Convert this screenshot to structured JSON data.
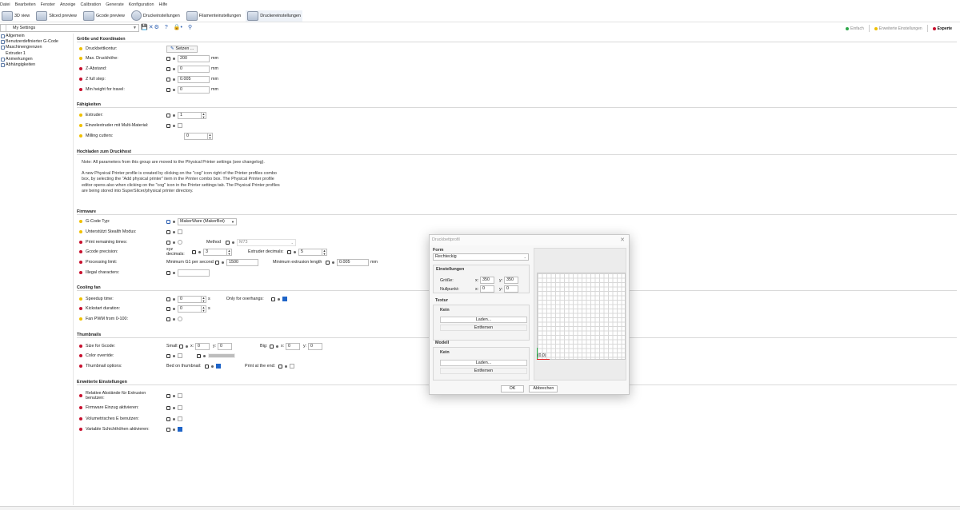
{
  "menu": [
    "Datei",
    "Bearbeiten",
    "Fenster",
    "Anzeige",
    "Calibration",
    "Generate",
    "Konfiguration",
    "Hilfe"
  ],
  "tabs": [
    {
      "label": "3D view"
    },
    {
      "label": "Sliced preview"
    },
    {
      "label": "Gcode preview"
    },
    {
      "label": "Druckeinstellungen"
    },
    {
      "label": "Filamenteinstellungen"
    },
    {
      "label": "Druckereinstellungen"
    }
  ],
  "toolbar": {
    "preset": "My Settings"
  },
  "modes": {
    "simple": "Einfach",
    "advanced": "Erweiterte Einstellungen",
    "expert": "Experte",
    "simple_color": "#2ea84a",
    "advanced_color": "#f0c000",
    "expert_color": "#c8102e"
  },
  "sidebar": [
    "Allgemein",
    "Benutzerdefinierter G-Code",
    "Maschinengrenzen",
    "Extruder 1",
    "Anmerkungen",
    "Abhängigkeiten"
  ],
  "size": {
    "header": "Größe und Koordinaten",
    "bed_shape": "Druckbettkontur:",
    "bed_btn": "Setzen ...",
    "max_height": "Max. Druckhöhe:",
    "max_height_v": "200",
    "max_height_u": "mm",
    "z_offset": "Z-Abstand:",
    "z_offset_v": "0",
    "z_offset_u": "mm",
    "z_step": "Z full step:",
    "z_step_v": "0.005",
    "z_step_u": "mm",
    "min_travel": "Min height for travel:",
    "min_travel_v": "0",
    "min_travel_u": "mm"
  },
  "caps": {
    "header": "Fähigkeiten",
    "extruders": "Extruder:",
    "extruders_v": "1",
    "single_multi": "Einzelextruder mit Multi-Material:",
    "milling": "Milling cutters:",
    "milling_v": "0"
  },
  "host": {
    "header": "Hochladen zum Druckhost",
    "note1": "Note: All parameters from this group are moved to the Physical Printer settings (see changelog).",
    "note2a": "A new Physical Printer profile is created by clicking on the \"cog\" icon right of the Printer profiles combo",
    "note2b": "box, by selecting the \"Add physical printer\" item in the Printer combo box. The Physical Printer profile",
    "note2c": "editor opens also when clicking on the \"cog\" icon in the Printer settings tab. The Physical Printer profiles",
    "note2d": "are being stored into SuperSlicer/physical printer directory."
  },
  "firmware": {
    "header": "Firmware",
    "gcode_type": "G-Code Typ:",
    "gcode_type_v": "MakerWare (MakerBot)",
    "stealth": "Unterstützt Stealth Modus:",
    "remaining": "Print remaining times:",
    "method": "Method",
    "method_v": "M73",
    "precision": "Gcode precision:",
    "xyz_dec": "xyz decimals:",
    "xyz_dec_v": "3",
    "ext_dec": "Extruder decimals:",
    "ext_dec_v": "5",
    "processing": "Processing limit:",
    "min_g1": "Minimum G1 per second:",
    "min_g1_v": "1500",
    "min_ext": "Minimum extrusion length",
    "min_ext_v": "0.005",
    "min_ext_u": "mm",
    "illegal": "Illegal characters:"
  },
  "cooling": {
    "header": "Cooling fan",
    "speedup": "Speedup time:",
    "speedup_v": "0",
    "speedup_u": "s",
    "overhangs": "Only for overhangs:",
    "kickstart": "Kickstart duration:",
    "kickstart_v": "0",
    "kickstart_u": "s",
    "pwm": "Fan PWM from 0-100:"
  },
  "thumbs": {
    "header": "Thumbnails",
    "size": "Size for Gcode:",
    "small": "Small:",
    "x": "x:",
    "y": "y:",
    "small_x": "0",
    "small_y": "0",
    "big": "Big:",
    "big_x": "0",
    "big_y": "0",
    "color": "Color override:",
    "options": "Thumbnail options:",
    "bed_on": "Bed on thumbnail:",
    "print_end": "Print at the end:"
  },
  "adv": {
    "header": "Erweiterte Einstellungen",
    "rel": "Relative Abstände für Extrusion",
    "rel2": "benutzen:",
    "retract": "Firmware Einzug aktivieren:",
    "vol": "Volumetrisches E benutzen:",
    "var": "Variable Schichthöhen aktivieren:"
  },
  "dialog": {
    "title": "Druckbettprofil",
    "form": "Form",
    "shape": "Rechteckig",
    "settings": "Einstellungen",
    "size": "Größe:",
    "size_x": "350",
    "size_y": "350",
    "origin": "Nullpunkt:",
    "origin_x": "0",
    "origin_y": "0",
    "x": "x:",
    "y": "y:",
    "texture": "Textur",
    "none": "Kein",
    "load": "Laden...",
    "remove": "Entfernen",
    "model": "Modell",
    "origin_label": "(0,0)",
    "ok": "OK",
    "cancel": "Abbrechen"
  }
}
